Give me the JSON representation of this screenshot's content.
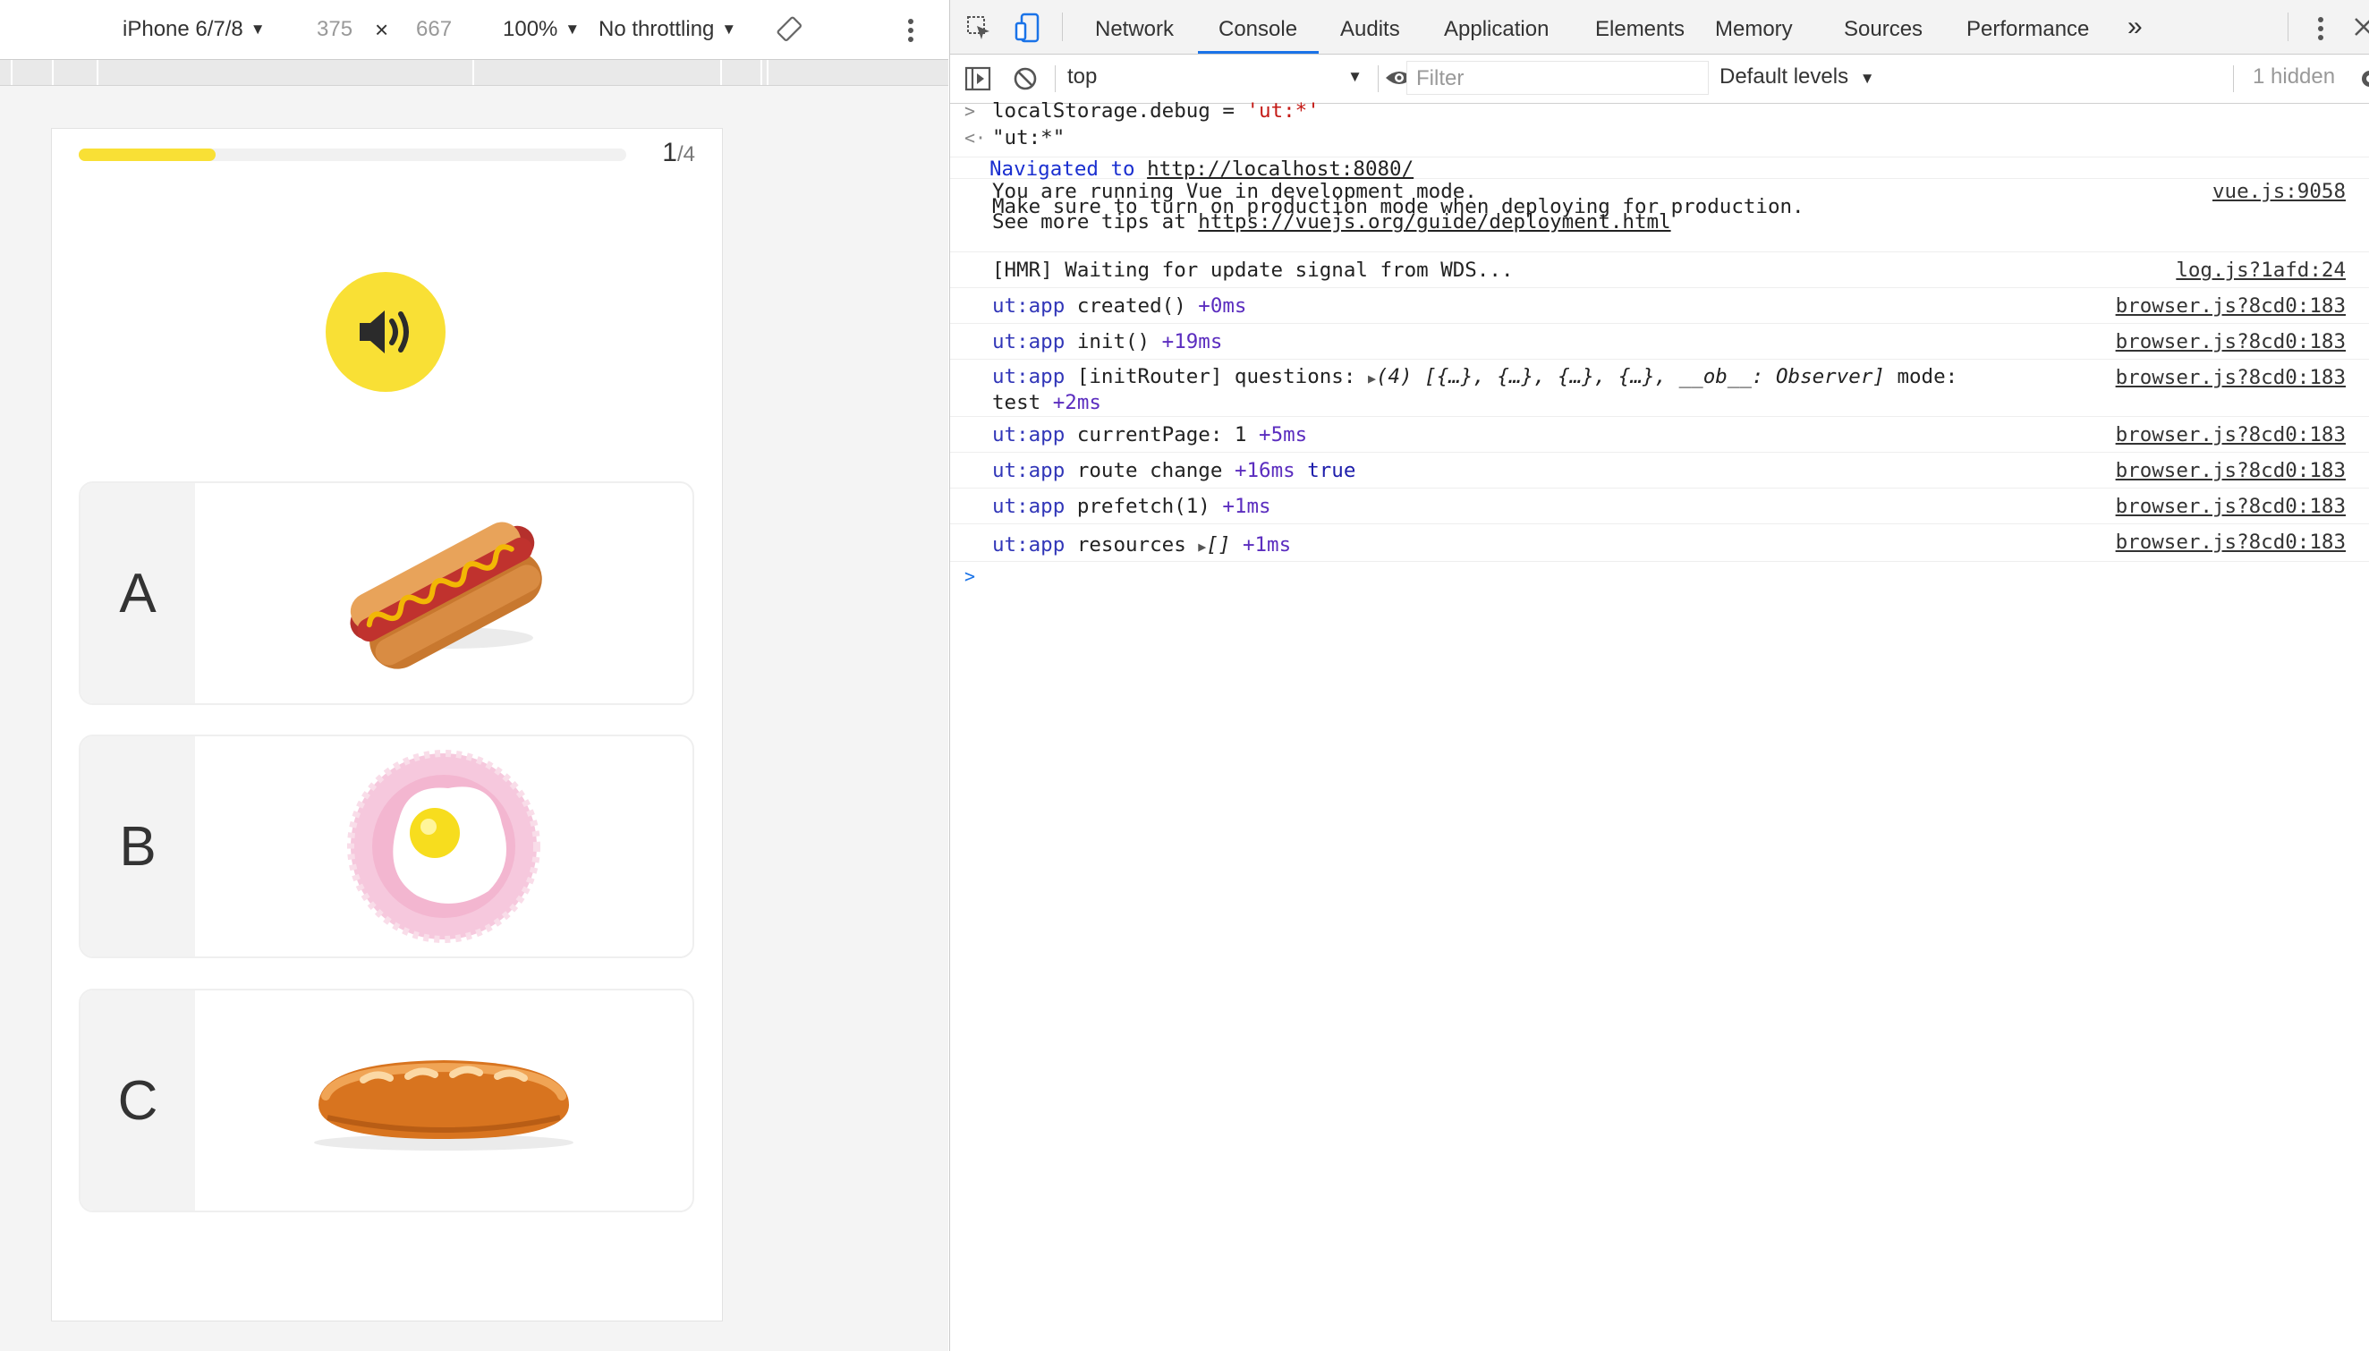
{
  "device_toolbar": {
    "device": "iPhone 6/7/8",
    "width": "375",
    "times": "×",
    "height": "667",
    "zoom": "100%",
    "throttling": "No throttling"
  },
  "app": {
    "progress_fraction": 0.25,
    "counter_current": "1",
    "counter_total": "/4",
    "options": [
      {
        "letter": "A",
        "image": "hot-dog"
      },
      {
        "letter": "B",
        "image": "fried-egg-on-plate"
      },
      {
        "letter": "C",
        "image": "baguette"
      }
    ]
  },
  "devtools": {
    "tabs": [
      "Network",
      "Console",
      "Audits",
      "Application",
      "Elements",
      "Memory",
      "Sources",
      "Performance"
    ],
    "active_tab": "Console",
    "more_tabs": "»",
    "context": "top",
    "filter_placeholder": "Filter",
    "levels": "Default levels",
    "hidden": "1 hidden"
  },
  "console": {
    "cmd": "localStorage.debug = 'ut:*'",
    "cmd_prefix": "localStorage.debug = ",
    "cmd_str": "'ut:*'",
    "result": "\"ut:*\"",
    "nav_label": "Navigated to",
    "nav_url": "http://localhost:8080/",
    "vue_line1": "You are running Vue in development mode.",
    "vue_line2": "Make sure to turn on production mode when deploying for production.",
    "vue_line3_prefix": "See more tips at ",
    "vue_line3_url": "https://vuejs.org/guide/deployment.html",
    "vue_src": "vue.js:9058",
    "hmr": "[HMR] Waiting for update signal from WDS...",
    "hmr_src": "log.js?1afd:24",
    "ns": "ut:app",
    "src_browser": "browser.js?8cd0:183",
    "l_created": "created()",
    "t_created": "+0ms",
    "l_init": "init()",
    "t_init": "+19ms",
    "l_router_a": "[initRouter] questions:",
    "l_router_obj": "(4) [{…}, {…}, {…}, {…}, __ob__: Observer]",
    "l_router_b": "mode:",
    "l_router_c": "test",
    "t_router": "+2ms",
    "l_page": "currentPage: 1",
    "t_page": "+5ms",
    "l_route": "route change",
    "t_route": "+16ms",
    "v_route": "true",
    "l_prefetch": "prefetch(1)",
    "t_prefetch": "+1ms",
    "l_res": "resources",
    "v_res": "[]",
    "t_res": "+1ms"
  }
}
